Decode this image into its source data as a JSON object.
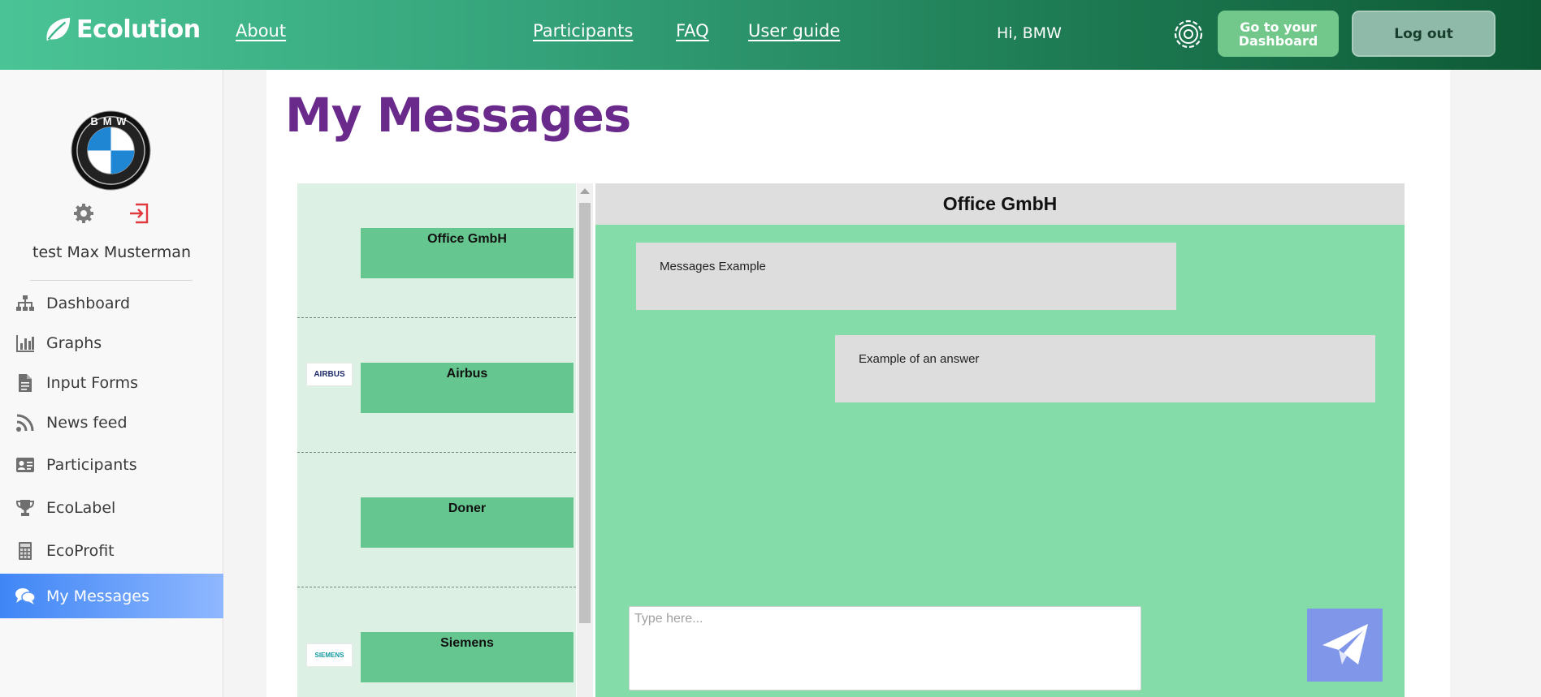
{
  "header": {
    "brand": "Ecolution",
    "nav": {
      "about": "About",
      "participants": "Participants",
      "faq": "FAQ",
      "user_guide": "User guide"
    },
    "greeting": "Hi, BMW",
    "dashboard_button": "Go to your Dashboard",
    "logout_button": "Log out",
    "colors": {
      "gradient_start": "#4ac496",
      "gradient_end": "#0e5a36"
    }
  },
  "sidebar": {
    "user_name": "test Max Musterman",
    "avatar_logo_text": "BMW",
    "items": [
      {
        "label": "Dashboard",
        "icon": "sitemap-icon"
      },
      {
        "label": "Graphs",
        "icon": "bar-chart-icon"
      },
      {
        "label": "Input Forms",
        "icon": "document-icon"
      },
      {
        "label": "News feed",
        "icon": "rss-icon"
      },
      {
        "label": "Participants",
        "icon": "id-card-icon"
      },
      {
        "label": "EcoLabel",
        "icon": "trophy-icon"
      },
      {
        "label": "EcoProfit",
        "icon": "calculator-icon"
      },
      {
        "label": "My Messages",
        "icon": "chat-icon",
        "active": true
      }
    ],
    "colors": {
      "active_start": "#3f86f5",
      "active_end": "#8fb7ff"
    }
  },
  "main": {
    "title": "My Messages",
    "contacts": [
      {
        "name": "Office GmbH",
        "logo": ""
      },
      {
        "name": "Airbus",
        "logo": "AIRBUS"
      },
      {
        "name": "Doner",
        "logo": ""
      },
      {
        "name": "Siemens",
        "logo": "SIEMENS"
      }
    ],
    "chat": {
      "partner": "Office GmbH",
      "messages": [
        {
          "direction": "in",
          "text": "Messages Example"
        },
        {
          "direction": "out",
          "text": "Example of an answer"
        }
      ],
      "input_placeholder": "Type here...",
      "send_icon": "paper-plane-icon"
    },
    "colors": {
      "title": "#6a2a8c",
      "chat_bg": "#84dca9",
      "contact_box": "#66c68f",
      "send_button": "#7f96e9"
    }
  }
}
